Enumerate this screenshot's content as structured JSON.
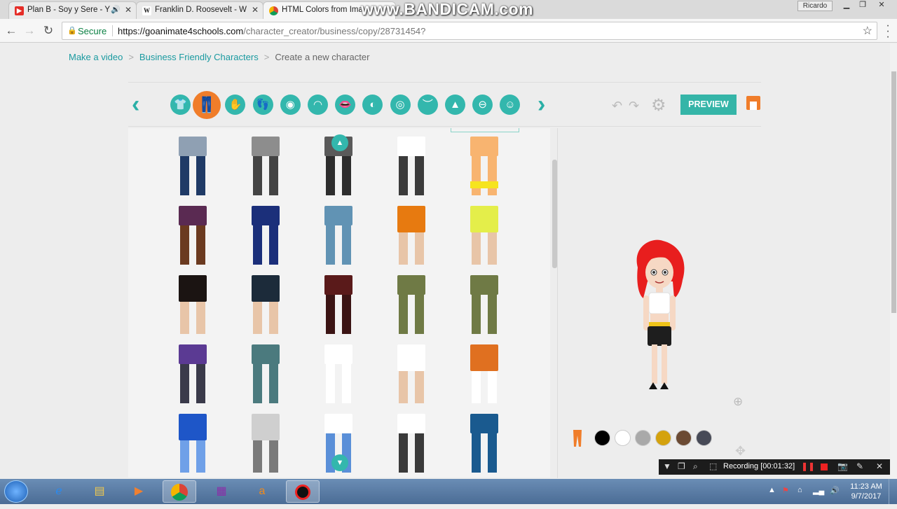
{
  "browser": {
    "tabs": [
      {
        "title": "Plan B - Soy y Sere - Y",
        "favicon": "youtube-icon",
        "color": "#e52d27",
        "audio": true
      },
      {
        "title": "Franklin D. Roosevelt - W",
        "favicon": "wikipedia-icon",
        "color": "#222222",
        "audio": false
      },
      {
        "title": "HTML Colors from Ima",
        "favicon": "chrome-web-icon",
        "color": "#4285f4",
        "audio": false
      }
    ],
    "user": "Ricardo",
    "secure_label": "Secure",
    "url_host": "https://goanimate4schools.com",
    "url_path": "/character_creator/business/copy/28731454?"
  },
  "watermark": "www.BANDICAM.com",
  "breadcrumb": {
    "items": [
      "Make a video",
      "Business Friendly Characters",
      "Create a new character"
    ],
    "separator": ">"
  },
  "category_bar": {
    "categories": [
      {
        "name": "upper-body-icon",
        "glyph": "👕"
      },
      {
        "name": "lower-body-icon",
        "glyph": "👖",
        "active": true
      },
      {
        "name": "hand-icon",
        "glyph": "✋"
      },
      {
        "name": "feet-icon",
        "glyph": "👣"
      },
      {
        "name": "head-shape-icon",
        "glyph": "◉"
      },
      {
        "name": "hair-icon",
        "glyph": "◠"
      },
      {
        "name": "mouth-icon",
        "glyph": "👄"
      },
      {
        "name": "ear-icon",
        "glyph": "◐"
      },
      {
        "name": "eye-icon",
        "glyph": "◎"
      },
      {
        "name": "eyebrow-icon",
        "glyph": "︶"
      },
      {
        "name": "nose-icon",
        "glyph": "▲"
      },
      {
        "name": "glasses-icon",
        "glyph": "⊖"
      },
      {
        "name": "face-mark-icon",
        "glyph": "☺"
      }
    ],
    "preview_label": "PREVIEW",
    "accent": "#33b7ad",
    "active_color": "#f07d2a"
  },
  "grid_items": [
    {
      "top": "#8fa0b3",
      "legs": "#1f3a66",
      "skin": false
    },
    {
      "top": "#8d8d8d",
      "legs": "#444444",
      "skin": false
    },
    {
      "top": "#5a5a5a",
      "legs": "#2d2d2d",
      "skin": false
    },
    {
      "top": "#ffffff",
      "legs": "#3b3b3b",
      "skin": false
    },
    {
      "top": "#f8b470",
      "legs": "#f8b470",
      "band": "#f6e41e",
      "skin": false
    },
    {
      "top": "#5a2a52",
      "legs": "#6b3a20",
      "skin": false
    },
    {
      "top": "#1b2f7a",
      "legs": "#1b2f7a",
      "skin": false
    },
    {
      "top": "#6193b4",
      "legs": "#6193b4",
      "skin": false
    },
    {
      "top": "#e77a10",
      "legs": "#e8c5a8",
      "skin": true
    },
    {
      "top": "#e4ee4a",
      "legs": "#e8c5a8",
      "skin": true
    },
    {
      "top": "#1b1412",
      "legs": "#e8c5a8",
      "skin": true
    },
    {
      "top": "#1c2b3a",
      "legs": "#e8c5a8",
      "skin": true
    },
    {
      "top": "#5a1a1a",
      "legs": "#3b1414",
      "skin": false
    },
    {
      "top": "#6f7a45",
      "legs": "#6f7a45",
      "skin": false
    },
    {
      "top": "#6f7a45",
      "legs": "#6f7a45",
      "skin": false
    },
    {
      "top": "#5b3a93",
      "legs": "#3a3a4a",
      "skin": false
    },
    {
      "top": "#4b7a7e",
      "legs": "#4b7a7e",
      "skin": false
    },
    {
      "top": "#ffffff",
      "legs": "#ffffff",
      "skin": false
    },
    {
      "top": "#ffffff",
      "legs": "#e8c5a8",
      "skin": true
    },
    {
      "top": "#e07020",
      "legs": "#ffffff",
      "skin": true
    },
    {
      "top": "#1e56c8",
      "legs": "#6fa0e8",
      "skin": true
    },
    {
      "top": "#cfcfcf",
      "legs": "#7a7a7a",
      "skin": true
    },
    {
      "top": "#ffffff",
      "legs": "#5a8fd8",
      "skin": false
    },
    {
      "top": "#ffffff",
      "legs": "#3a3a3a",
      "skin": false
    },
    {
      "top": "#1a5a8f",
      "legs": "#1a5a8f",
      "skin": false
    }
  ],
  "swatches": [
    "#000000",
    "#ffffff",
    "#a9a9a9",
    "#d4a20e",
    "#6b4a33",
    "#474a57"
  ],
  "recording": {
    "label": "Recording [00:01:32]"
  },
  "taskbar": {
    "apps": [
      "windows-explorer-icon",
      "internet-explorer-icon",
      "file-explorer-icon",
      "media-player-icon",
      "chrome-icon",
      "winrar-icon",
      "avast-icon",
      "bandicam-icon"
    ],
    "time": "11:23 AM",
    "date": "9/7/2017"
  }
}
